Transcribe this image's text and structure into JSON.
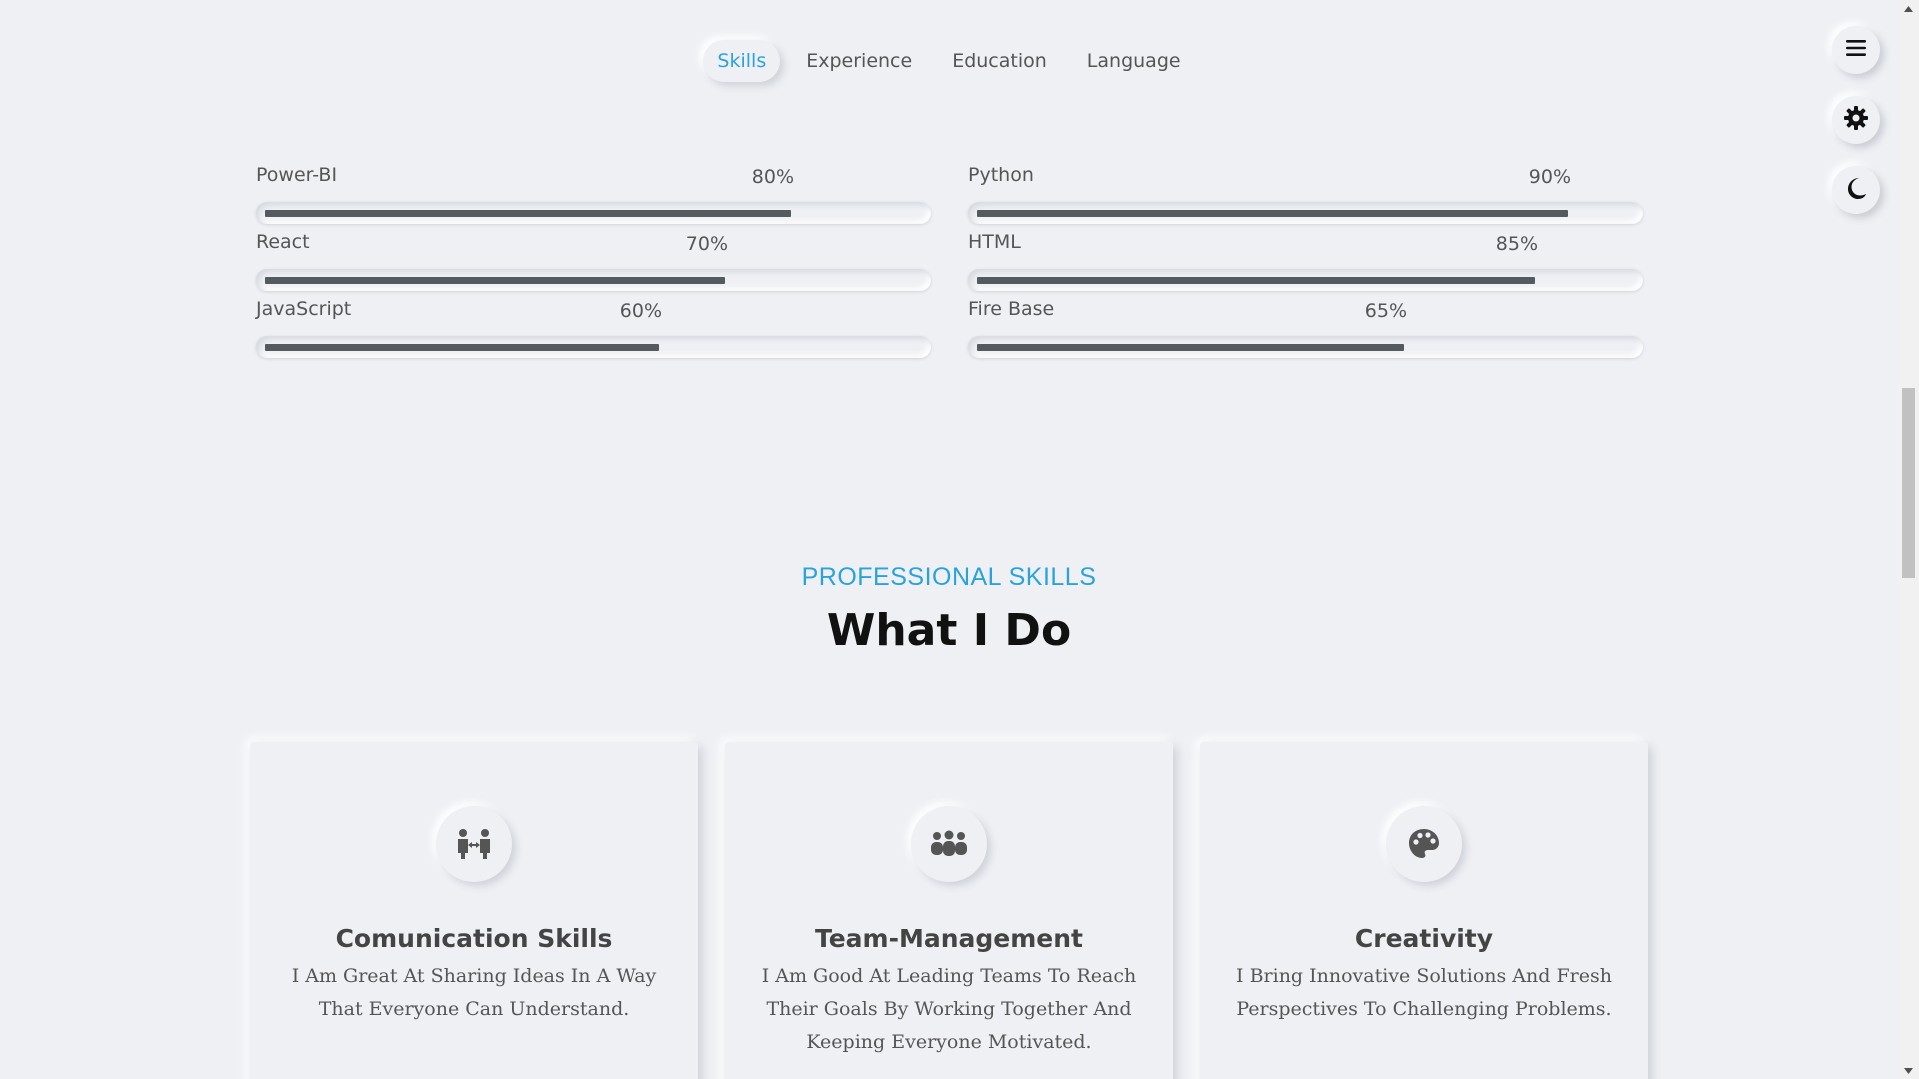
{
  "tabs": [
    {
      "label": "Skills",
      "active": true
    },
    {
      "label": "Experience",
      "active": false
    },
    {
      "label": "Education",
      "active": false
    },
    {
      "label": "Language",
      "active": false
    }
  ],
  "skills": [
    {
      "name": "Power-BI",
      "percent_label": "80%",
      "value": 80
    },
    {
      "name": "Python",
      "percent_label": "90%",
      "value": 90
    },
    {
      "name": "React",
      "percent_label": "70%",
      "value": 70
    },
    {
      "name": "HTML",
      "percent_label": "85%",
      "value": 85
    },
    {
      "name": "JavaScript",
      "percent_label": "60%",
      "value": 60
    },
    {
      "name": "Fire Base",
      "percent_label": "65%",
      "value": 65
    }
  ],
  "section": {
    "kicker": "PROFESSIONAL SKILLS",
    "title": "What I Do"
  },
  "cards": [
    {
      "icon": "people-arrows-icon",
      "title": "Comunication Skills",
      "text": "I Am Great At Sharing Ideas In A Way That Everyone Can Understand."
    },
    {
      "icon": "people-group-icon",
      "title": "Team-Management",
      "text": "I Am Good At Leading Teams To Reach Their Goals By Working Together And Keeping Everyone Motivated."
    },
    {
      "icon": "palette-icon",
      "title": "Creativity",
      "text": "I Bring Innovative Solutions And Fresh Perspectives To Challenging Problems."
    }
  ],
  "floating_buttons": [
    {
      "icon": "menu-icon"
    },
    {
      "icon": "gear-icon"
    },
    {
      "icon": "moon-icon"
    }
  ],
  "colors": {
    "accent": "#2aa3dc",
    "background": "#eef0f4",
    "bar_fill": "#555a5e",
    "title": "#111111"
  }
}
